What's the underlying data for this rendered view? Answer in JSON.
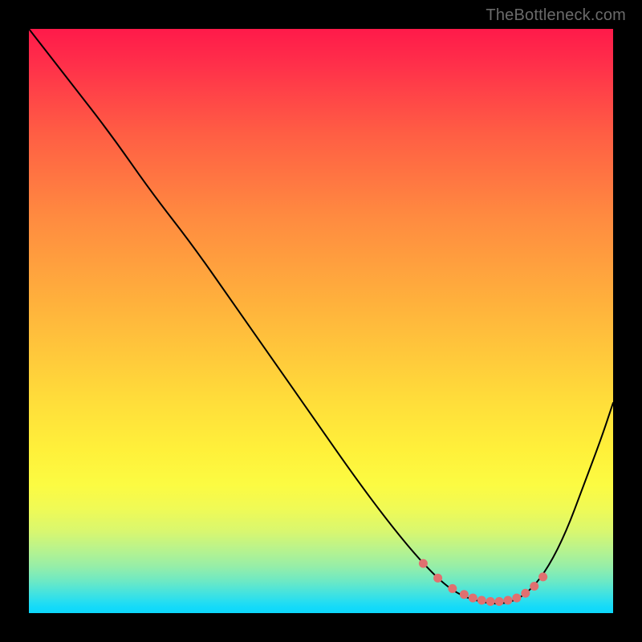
{
  "watermark": "TheBottleneck.com",
  "chart_data": {
    "type": "line",
    "title": "",
    "xlabel": "",
    "ylabel": "",
    "xlim": [
      0,
      100
    ],
    "ylim": [
      0,
      100
    ],
    "grid": false,
    "legend": false,
    "curve": {
      "stroke": "#000000",
      "width": 2,
      "x": [
        0,
        7,
        14,
        21,
        28,
        35,
        42,
        49,
        56,
        62,
        67,
        71,
        74,
        77,
        80,
        83,
        86,
        89,
        92,
        95,
        98,
        100
      ],
      "y": [
        100,
        91,
        82,
        72,
        63,
        53,
        43,
        33,
        23,
        15,
        9,
        5,
        3,
        2,
        1.5,
        2,
        4,
        8,
        14,
        22,
        30,
        36
      ]
    },
    "markers": {
      "color": "#e07070",
      "radius": 5.5,
      "x": [
        67.5,
        70,
        72.5,
        74.5,
        76,
        77.5,
        79,
        80.5,
        82,
        83.5,
        85,
        86.5,
        88
      ],
      "y": [
        8.5,
        6.0,
        4.2,
        3.2,
        2.6,
        2.2,
        2.0,
        2.0,
        2.2,
        2.6,
        3.4,
        4.6,
        6.2
      ]
    },
    "gradient_stops": [
      {
        "pos": 0.0,
        "color": "#ff1a4a"
      },
      {
        "pos": 0.25,
        "color": "#ff7442"
      },
      {
        "pos": 0.5,
        "color": "#ffb43c"
      },
      {
        "pos": 0.78,
        "color": "#fcfb42"
      },
      {
        "pos": 0.92,
        "color": "#96eea8"
      },
      {
        "pos": 1.0,
        "color": "#0cd8fb"
      }
    ]
  }
}
